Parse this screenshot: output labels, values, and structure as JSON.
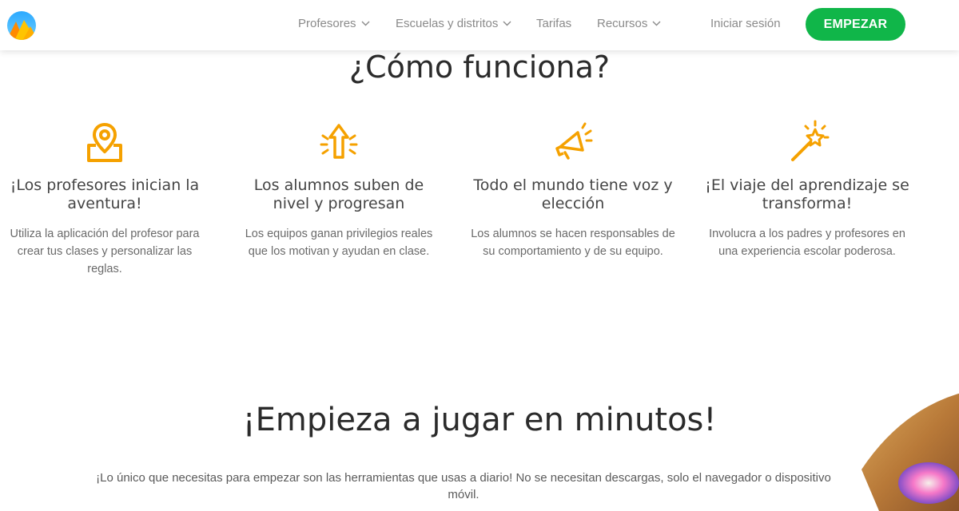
{
  "header": {
    "logo_icon": "mountain-logo-icon",
    "nav": [
      {
        "label": "Profesores",
        "has_dropdown": true
      },
      {
        "label": "Escuelas y distritos",
        "has_dropdown": true
      },
      {
        "label": "Tarifas",
        "has_dropdown": false
      },
      {
        "label": "Recursos",
        "has_dropdown": true
      }
    ],
    "login_label": "Iniciar sesión",
    "start_label": "EMPEZAR",
    "start_color": "#10b649"
  },
  "how": {
    "title": "¿Cómo funciona?",
    "accent": "#f5a100",
    "items": [
      {
        "icon": "map-pin-icon",
        "title": "¡Los profesores inician la aventura!",
        "text": "Utiliza la aplicación del profesor para crear tus clases y personalizar las reglas."
      },
      {
        "icon": "arrow-up-icon",
        "title": "Los alumnos suben de nivel y progresan",
        "text": "Los equipos ganan privilegios reales que los motivan y ayudan en clase."
      },
      {
        "icon": "megaphone-icon",
        "title": "Todo el mundo tiene voz y elección",
        "text": "Los alumnos se hacen responsables de su comportamiento y de su equipo."
      },
      {
        "icon": "magic-wand-icon",
        "title": "¡El viaje del aprendizaje se transforma!",
        "text": "Involucra a los padres y profesores en una experiencia escolar poderosa."
      }
    ]
  },
  "start": {
    "title": "¡Empieza a jugar en minutos!",
    "text": "¡Lo único que necesitas para empezar son las herramientas que usas a diario! No se necesitan descargas, solo el navegador o dispositivo móvil."
  }
}
